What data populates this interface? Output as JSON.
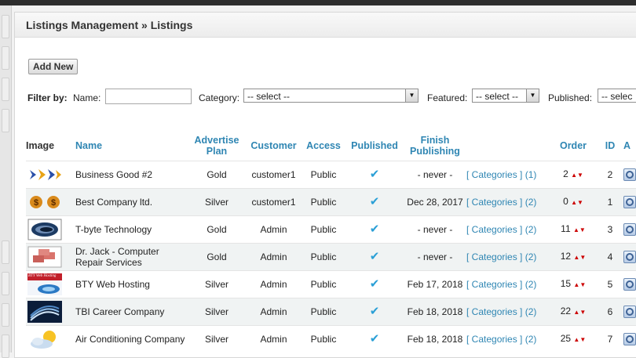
{
  "header": {
    "title": "Listings Management » Listings"
  },
  "toolbar": {
    "add_new_label": "Add New"
  },
  "filters": {
    "filter_by_label": "Filter by:",
    "name_label": "Name:",
    "name_value": "",
    "category_label": "Category:",
    "category_value": "-- select --",
    "featured_label": "Featured:",
    "featured_value": "-- select --",
    "published_label": "Published:",
    "published_value": "-- selec"
  },
  "table": {
    "columns": {
      "image": "Image",
      "name": "Name",
      "advertise_plan": "Advertise Plan",
      "customer": "Customer",
      "access": "Access",
      "published": "Published",
      "finish_publishing": "Finish Publishing",
      "order": "Order",
      "id": "ID",
      "actions": "A"
    },
    "rows": [
      {
        "name": "Business Good #2",
        "plan": "Gold",
        "customer": "customer1",
        "access": "Public",
        "published": "✔",
        "finish": "- never -",
        "categories": "[ Categories ] (1)",
        "order": "2",
        "id": "2",
        "image": "arrows-logo-icon"
      },
      {
        "name": "Best Company ltd.",
        "plan": "Silver",
        "customer": "customer1",
        "access": "Public",
        "published": "✔",
        "finish": "Dec 28, 2017",
        "categories": "[ Categories ] (2)",
        "order": "0",
        "id": "1",
        "image": "dollar-coins-icon"
      },
      {
        "name": "T-byte Technology",
        "plan": "Gold",
        "customer": "Admin",
        "access": "Public",
        "published": "✔",
        "finish": "- never -",
        "categories": "[ Categories ] (2)",
        "order": "11",
        "id": "3",
        "image": "globe-logo-icon"
      },
      {
        "name": "Dr. Jack - Computer Repair Services",
        "plan": "Gold",
        "customer": "Admin",
        "access": "Public",
        "published": "✔",
        "finish": "- never -",
        "categories": "[ Categories ] (2)",
        "order": "12",
        "id": "4",
        "image": "bricks-logo-icon"
      },
      {
        "name": "BTY Web Hosting",
        "plan": "Silver",
        "customer": "Admin",
        "access": "Public",
        "published": "✔",
        "finish": "Feb 17, 2018",
        "categories": "[ Categories ] (2)",
        "order": "15",
        "id": "5",
        "image": "web-hosting-logo-icon",
        "thumb_text": "BTY Web Hosting"
      },
      {
        "name": "TBI Career Company",
        "plan": "Silver",
        "customer": "Admin",
        "access": "Public",
        "published": "✔",
        "finish": "Feb 18, 2018",
        "categories": "[ Categories ] (2)",
        "order": "22",
        "id": "6",
        "image": "stripes-logo-icon"
      },
      {
        "name": "Air Conditioning Company",
        "plan": "Silver",
        "customer": "Admin",
        "access": "Public",
        "published": "✔",
        "finish": "Feb 18, 2018",
        "categories": "[ Categories ] (2)",
        "order": "25",
        "id": "7",
        "image": "sun-cloud-icon"
      }
    ],
    "order_up_symbol": "▲",
    "order_down_symbol": "▼",
    "action_separator": "|"
  },
  "colors": {
    "link": "#2f86b3",
    "check": "#2a9fd6",
    "arrow": "#cc0000",
    "row_alt": "#f0f3f3"
  }
}
